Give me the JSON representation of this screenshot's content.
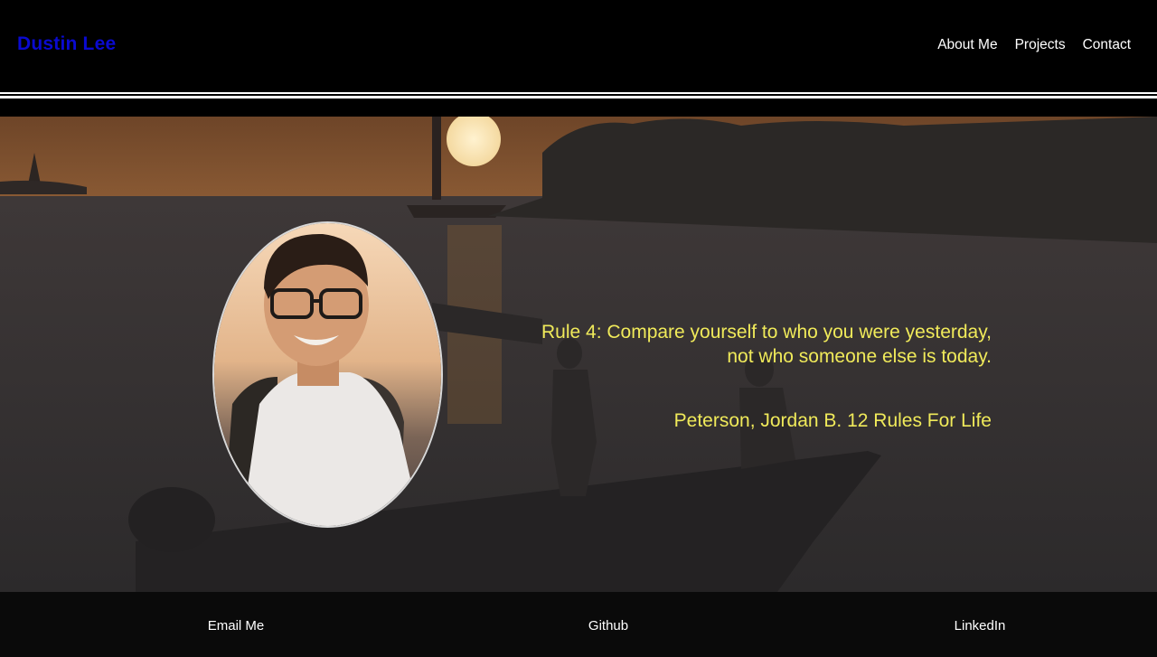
{
  "header": {
    "brand": "Dustin Lee",
    "nav": [
      "About Me",
      "Projects",
      "Contact"
    ]
  },
  "hero": {
    "quote_line1": "Rule 4: Compare yourself to who you were yesterday,",
    "quote_line2": "not who someone else is today.",
    "attribution": "Peterson, Jordan B. 12 Rules For Life"
  },
  "footer": {
    "links": [
      "Email Me",
      "Github",
      "LinkedIn"
    ]
  },
  "colors": {
    "brand": "#0a0ad0",
    "quote": "#f0ea5a",
    "header_bg": "#000000"
  }
}
